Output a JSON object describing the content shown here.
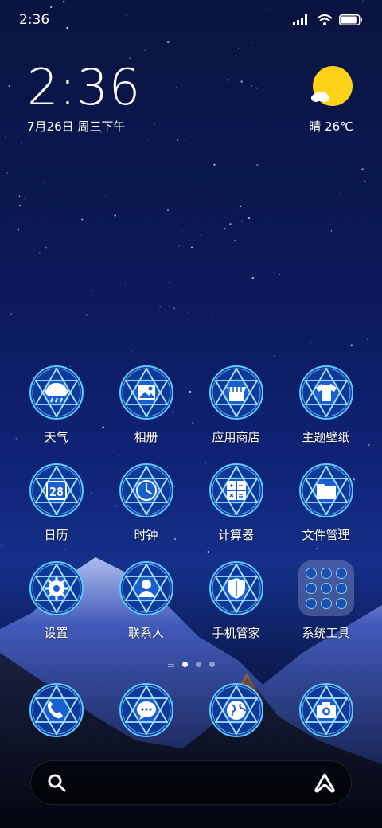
{
  "status_bar": {
    "time": "2:36",
    "battery_level": 0.9
  },
  "clock_widget": {
    "time": "2:36",
    "date": "7月26日 周三下午"
  },
  "weather_widget": {
    "text": "晴 26℃",
    "icon": "sun-cloud-icon"
  },
  "apps": [
    {
      "label": "天气",
      "icon": "cloud-rain-icon"
    },
    {
      "label": "相册",
      "icon": "gallery-icon"
    },
    {
      "label": "应用商店",
      "icon": "store-icon"
    },
    {
      "label": "主题壁纸",
      "icon": "tshirt-icon"
    },
    {
      "label": "日历",
      "icon": "calendar-icon",
      "glyph": "28"
    },
    {
      "label": "时钟",
      "icon": "clock-icon"
    },
    {
      "label": "计算器",
      "icon": "calculator-icon"
    },
    {
      "label": "文件管理",
      "icon": "folder-icon"
    },
    {
      "label": "设置",
      "icon": "gear-icon"
    },
    {
      "label": "联系人",
      "icon": "contact-icon"
    },
    {
      "label": "手机管家",
      "icon": "shield-icon"
    },
    {
      "label": "系统工具",
      "icon": "folder-group-icon"
    }
  ],
  "page_indicator": {
    "pages": 3,
    "active": 1
  },
  "dock": [
    {
      "icon": "phone-icon"
    },
    {
      "icon": "message-icon"
    },
    {
      "icon": "browser-icon"
    },
    {
      "icon": "camera-icon"
    }
  ],
  "search": {
    "left_icon": "search-icon",
    "right_icon": "assistant-icon"
  },
  "colors": {
    "accent": "#5cc8ff",
    "icon_bg": "#1a5fd0",
    "sun": "#ffd21a"
  }
}
